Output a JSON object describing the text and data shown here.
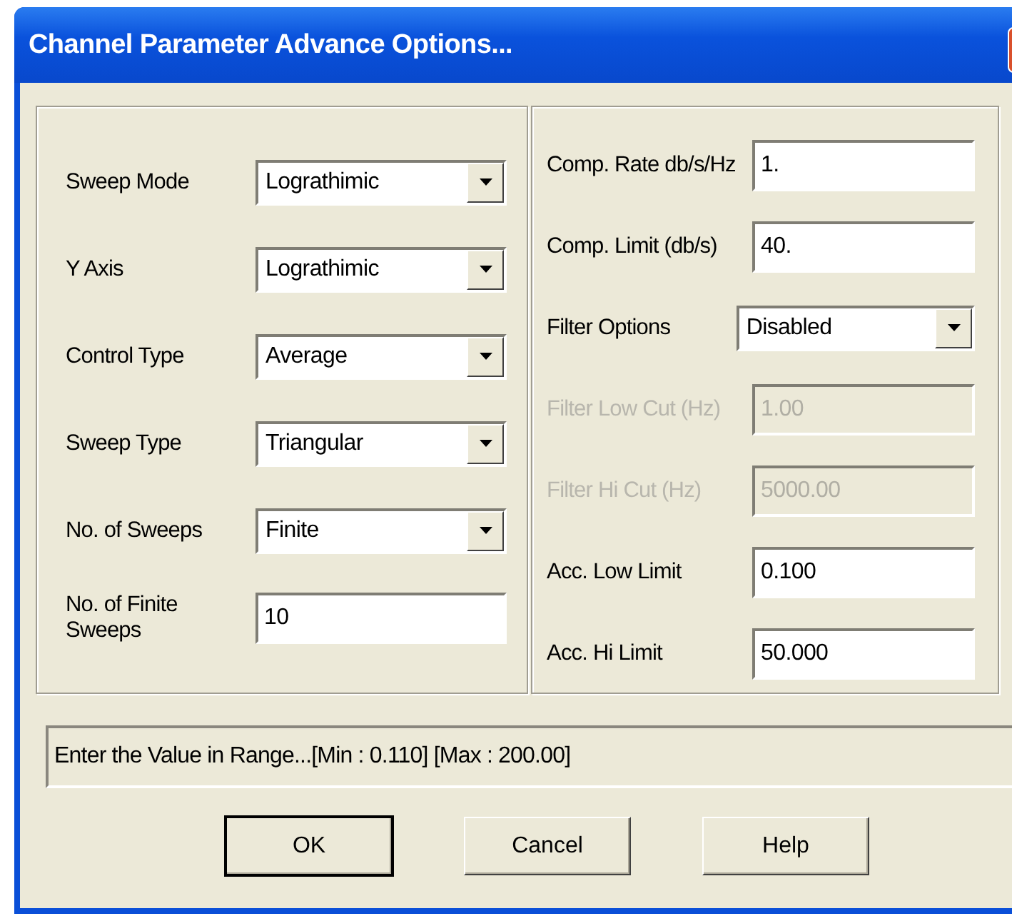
{
  "window": {
    "title": "Channel Parameter Advance Options..."
  },
  "left_panel": {
    "rows": [
      {
        "kind": "dropdown",
        "label": "Sweep Mode",
        "value": "Lograthimic"
      },
      {
        "kind": "dropdown",
        "label": "Y Axis",
        "value": "Lograthimic"
      },
      {
        "kind": "dropdown",
        "label": "Control Type",
        "value": "Average"
      },
      {
        "kind": "dropdown",
        "label": "Sweep Type",
        "value": "Triangular"
      },
      {
        "kind": "dropdown",
        "label": "No. of Sweeps",
        "value": "Finite"
      },
      {
        "kind": "text",
        "label": "No. of Finite Sweeps",
        "value": "10"
      }
    ]
  },
  "right_panel": {
    "rows": [
      {
        "kind": "text",
        "label": "Comp. Rate db/s/Hz",
        "value": "1.",
        "disabled": false
      },
      {
        "kind": "text",
        "label": "Comp. Limit (db/s)",
        "value": "40.",
        "disabled": false
      },
      {
        "kind": "dropdown",
        "label": "Filter Options",
        "value": "Disabled",
        "disabled": false
      },
      {
        "kind": "text",
        "label": "Filter Low Cut (Hz)",
        "value": "1.00",
        "disabled": true
      },
      {
        "kind": "text",
        "label": "Filter Hi Cut (Hz)",
        "value": "5000.00",
        "disabled": true
      },
      {
        "kind": "text",
        "label": "Acc. Low Limit",
        "value": "0.100",
        "disabled": false
      },
      {
        "kind": "text",
        "label": "Acc. Hi Limit",
        "value": "50.000",
        "disabled": false
      }
    ]
  },
  "status_field": {
    "value": "Enter the Value in Range...[Min : 0.110] [Max : 200.00]"
  },
  "buttons": [
    {
      "label": "OK",
      "default": true
    },
    {
      "label": "Cancel",
      "default": false
    },
    {
      "label": "Help",
      "default": false
    }
  ]
}
